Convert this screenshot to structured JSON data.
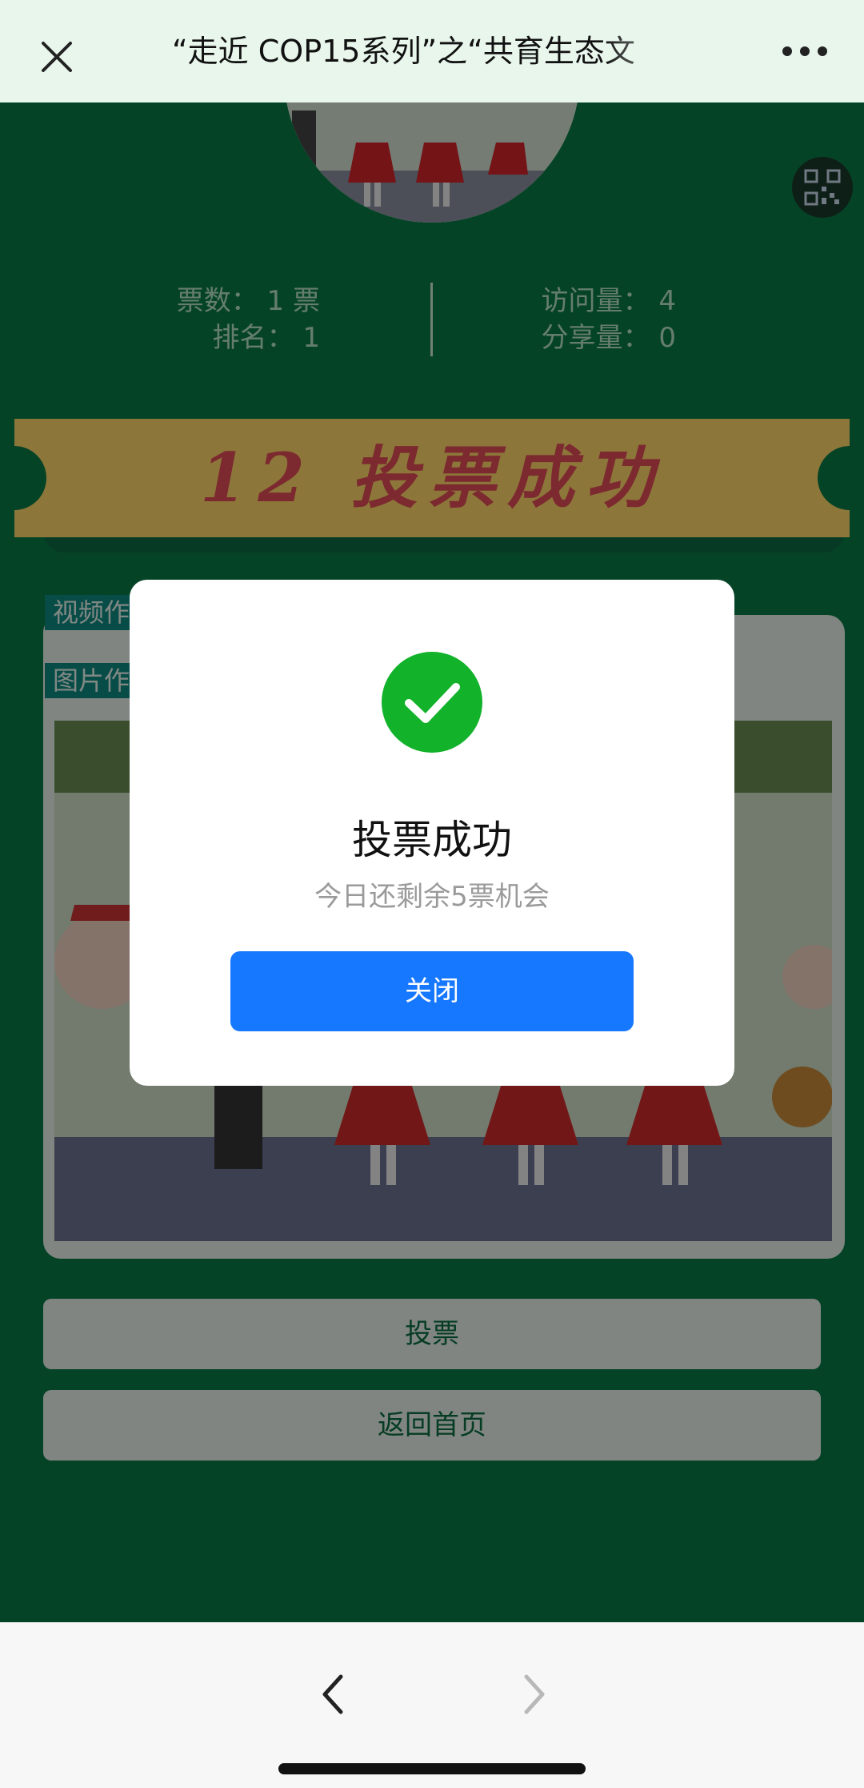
{
  "topbar": {
    "title": "“走近 COP15系列”之“共育生态文",
    "close_icon": "close-icon",
    "more_icon": "more-icon"
  },
  "stats": {
    "votes_label": "票数：",
    "votes_value": "1 票",
    "rank_label": "排名：",
    "rank_value": "1",
    "visits_label": "访问量：",
    "visits_value": "4",
    "shares_label": "分享量：",
    "shares_value": "0"
  },
  "banner": {
    "text": "12 投票成功"
  },
  "sections": {
    "video_tag": "视频作",
    "image_tag": "图片作"
  },
  "buttons": {
    "vote": "投票",
    "home": "返回首页"
  },
  "modal": {
    "title": "投票成功",
    "subtitle": "今日还剩余5票机会",
    "close_button": "关闭",
    "success_color": "#12b22a",
    "button_color": "#1677ff"
  },
  "bottombar": {
    "back_icon": "chevron-left-icon",
    "forward_icon": "chevron-right-icon"
  }
}
